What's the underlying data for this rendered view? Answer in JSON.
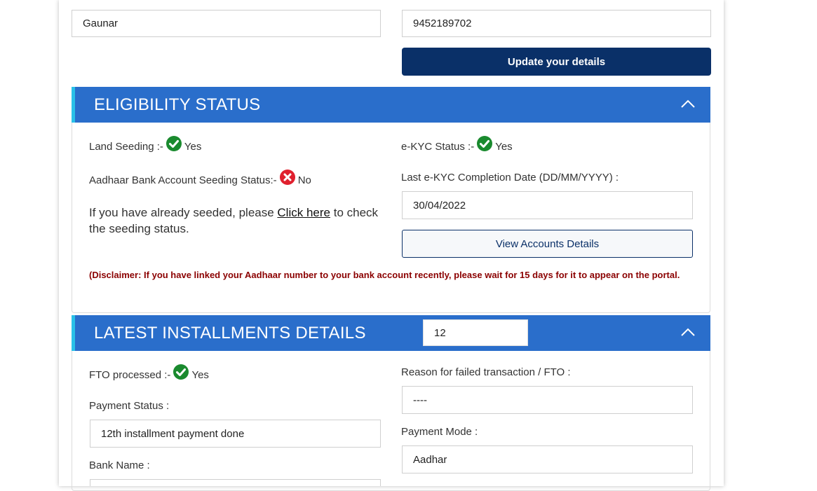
{
  "top": {
    "name_value": "Gaunar",
    "mobile_value": "9452189702",
    "update_button": "Update your details"
  },
  "eligibility": {
    "title": "ELIGIBILITY STATUS",
    "land_seeding_label": "Land Seeding :-",
    "land_seeding_value": "Yes",
    "ekyc_label": "e-KYC Status :-",
    "ekyc_value": "Yes",
    "aadhaar_seeding_label": "Aadhaar Bank Account Seeding Status:-",
    "aadhaar_seeding_value": "No",
    "seeded_text_before": "If you have already seeded, please ",
    "seeded_link": "Click here",
    "seeded_text_after": " to check the seeding status.",
    "ekyc_date_label": "Last e-KYC Completion Date (DD/MM/YYYY) :",
    "ekyc_date_value": "30/04/2022",
    "view_accounts_button": "View Accounts Details",
    "disclaimer": "(Disclaimer: If you have linked your Aadhaar number to your bank account recently, please wait for 15 days for it to appear on the portal."
  },
  "installments": {
    "title": "LATEST INSTALLMENTS DETAILS",
    "installment_number": "12",
    "fto_label": "FTO processed :-",
    "fto_value": "Yes",
    "failed_reason_label": "Reason for failed transaction / FTO :",
    "failed_reason_value": "----",
    "payment_status_label": "Payment Status :",
    "payment_status_value": "12th installment payment done",
    "payment_mode_label": "Payment Mode :",
    "payment_mode_value": "Aadhar",
    "bank_name_label": "Bank Name :"
  },
  "colors": {
    "header_blue": "#2a6ecb",
    "header_accent": "#29c1e8",
    "button_navy": "#0a3068",
    "success_green": "#1a8a2e",
    "error_red": "#e0202e",
    "disclaimer_red": "#8b0000"
  }
}
